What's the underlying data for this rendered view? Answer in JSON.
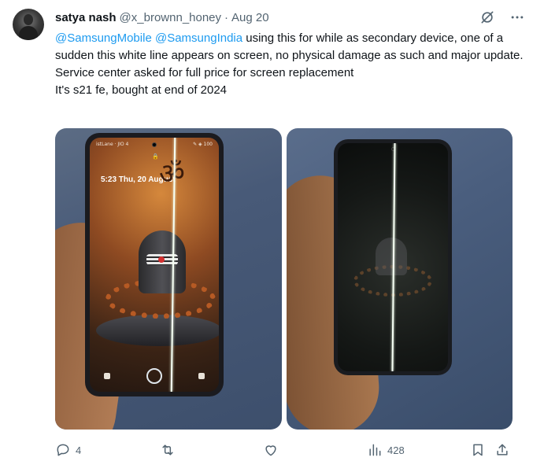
{
  "tweet": {
    "display_name": "satya nash",
    "handle": "@x_brownn_honey",
    "separator": "·",
    "date": "Aug 20",
    "text": {
      "mention1": "@SamsungMobile",
      "mention2": "@SamsungIndia",
      "line1_rest": " using this for while as secondary device, one of a sudden this white line appears on screen, no physical damage as such and major update. Service center asked for full price for screen replacement",
      "line2": "It's s21 fe, bought at end of 2024"
    },
    "media": {
      "left_photo": {
        "status_left": "istLane · JIO 4",
        "status_right": "✎ ◈ 100",
        "lock_glyph": "🔒",
        "clock_text": "5:23  Thu, 20 August",
        "om_glyph": "ॐ"
      }
    },
    "actions": {
      "reply_count": "4",
      "retweet_count": "",
      "like_count": "",
      "views_count": "428"
    },
    "colors": {
      "accent": "#1d9bf0",
      "secondary_text": "#536471",
      "primary_text": "#0f1419"
    },
    "icons": {
      "top": [
        "grok-icon",
        "more-icon"
      ],
      "actions": [
        "reply-icon",
        "retweet-icon",
        "like-icon",
        "views-icon",
        "bookmark-icon",
        "share-icon"
      ]
    }
  }
}
